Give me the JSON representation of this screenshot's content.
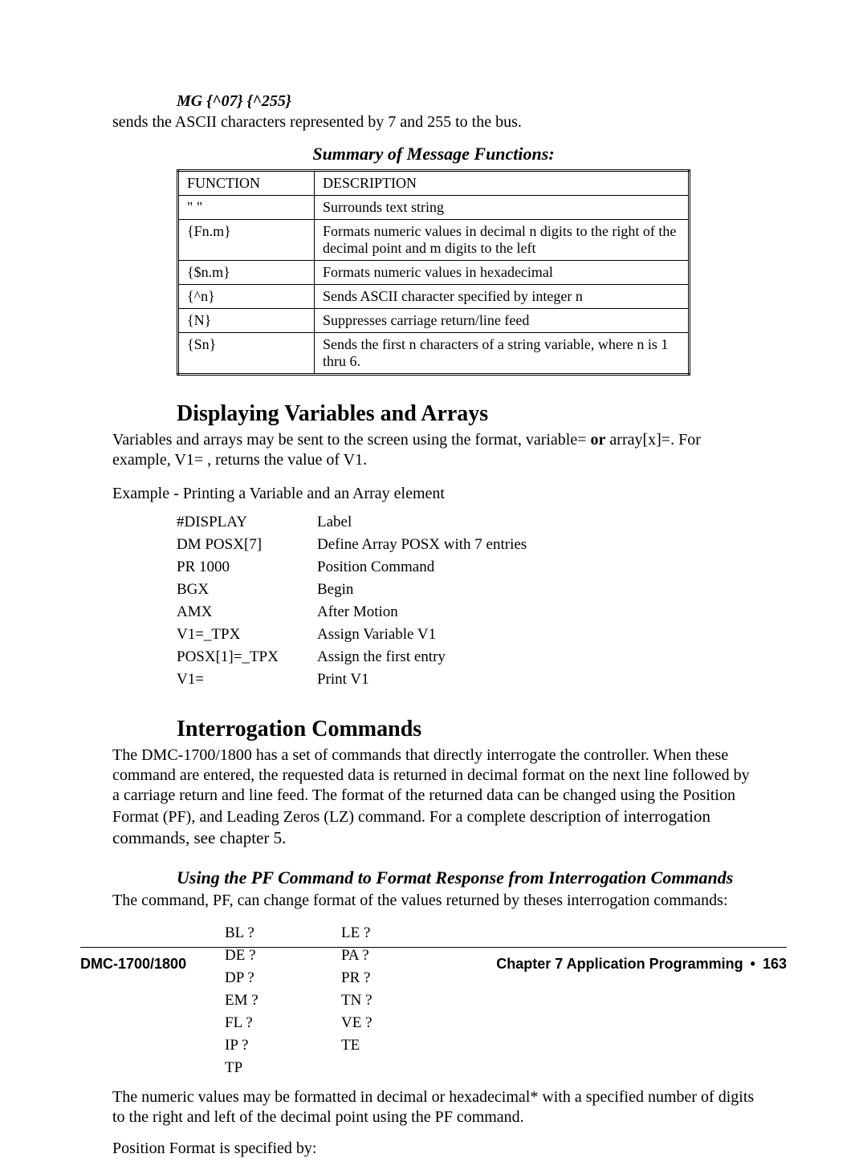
{
  "mg_example": "MG {^07} {^255}",
  "mg_explain": "sends the ASCII characters represented by 7 and 255 to the bus.",
  "summary_title": "Summary of Message Functions:",
  "table_header": {
    "func": "FUNCTION",
    "desc": "DESCRIPTION"
  },
  "func_rows": [
    {
      "f": "\" \"",
      "d": "Surrounds text string"
    },
    {
      "f": "{Fn.m}",
      "d": "Formats numeric values in decimal n digits to the right of the decimal point and m digits to the left"
    },
    {
      "f": "{$n.m}",
      "d": "Formats numeric values in hexadecimal"
    },
    {
      "f": "{^n}",
      "d": "Sends ASCII character specified by integer n"
    },
    {
      "f": "{N}",
      "d": "Suppresses carriage return/line feed"
    },
    {
      "f": "{Sn}",
      "d": "Sends the first n characters of a string variable, where n is 1 thru 6."
    }
  ],
  "sec1_title": "Displaying Variables and Arrays",
  "sec1_p_parts": {
    "a": "Variables and arrays may be sent to the screen using the format, variable= ",
    "b": "or",
    "c": " array[x]=.  For example, V1=   , returns the value of V1."
  },
  "example_heading": "Example - Printing a Variable and an Array element",
  "example_rows": [
    {
      "a": "#DISPLAY",
      "b": "Label"
    },
    {
      "a": "DM POSX[7]",
      "b": "Define Array POSX with 7 entries"
    },
    {
      "a": "PR 1000",
      "b": "Position Command"
    },
    {
      "a": "BGX",
      "b": "Begin"
    },
    {
      "a": "AMX",
      "b": "After Motion"
    },
    {
      "a": "V1=_TPX",
      "b": "Assign Variable V1"
    },
    {
      "a": "POSX[1]=_TPX",
      "b": "Assign the first entry"
    },
    {
      "a": "V1=",
      "b": "Print V1"
    }
  ],
  "sec2_title": "Interrogation Commands",
  "sec2_p_parts": {
    "a": "The DMC-1700/1800 has a set of commands that directly interrogate the controller.  When these command are entered, the requested data is returned in decimal format on the next line followed by a carriage return and line feed.  The format of the returned data can be changed using the Position Format (PF), and Leading Zeros (LZ) command. For a complete description ",
    "b": "of interrogation commands, see chapter 5."
  },
  "sub_title": "Using the PF Command to Format Response from Interrogation Commands",
  "sub_p": "The command, PF, can change format of the values returned by theses interrogation commands:",
  "cmd_rows": [
    {
      "a": "BL ?",
      "b": "LE ?"
    },
    {
      "a": "DE ?",
      "b": "PA ?"
    },
    {
      "a": "DP ?",
      "b": "PR ?"
    },
    {
      "a": "EM ?",
      "b": "TN ?"
    },
    {
      "a": "FL ?",
      "b": "VE ?"
    },
    {
      "a": "IP ?",
      "b": "TE"
    },
    {
      "a": "TP",
      "b": ""
    }
  ],
  "after_cmds_p": "The numeric values may be formatted in decimal or hexadecimal* with a specified number of digits to the right and left of the decimal point using the PF command.",
  "pf_spec_p": "Position Format is specified by:",
  "footer": {
    "left": "DMC-1700/1800",
    "right_chapter": "Chapter 7 Application Programming",
    "bullet": "•",
    "page": "163"
  }
}
